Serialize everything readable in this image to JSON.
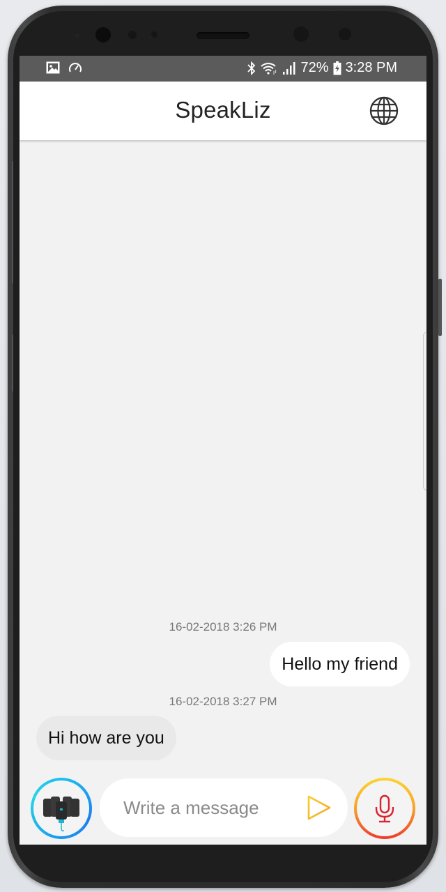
{
  "status_bar": {
    "left_icons": [
      "image-icon",
      "speedometer-icon"
    ],
    "right_icons": [
      "bluetooth-icon",
      "wifi-icon",
      "signal-icon"
    ],
    "battery": "72%",
    "battery_icon": "battery-charging-icon",
    "time": "3:28 PM"
  },
  "app_bar": {
    "title": "SpeakLiz",
    "language_icon": "globe-icon"
  },
  "messages": [
    {
      "timestamp": "16-02-2018  3:26 PM",
      "text": "Hello my friend",
      "direction": "outgoing"
    },
    {
      "timestamp": "16-02-2018  3:27 PM",
      "text": "Hi how are you",
      "direction": "incoming"
    }
  ],
  "composer": {
    "device_button_icon": "wearable-device-icon",
    "placeholder": "Write a message",
    "value": "",
    "send_icon": "send-triangle-icon",
    "mic_icon": "microphone-icon"
  },
  "colors": {
    "status_bar": "#5b5b5b",
    "chat_background": "#f2f2f2",
    "outgoing_bubble": "#ffffff",
    "incoming_bubble": "#e9e9e9",
    "device_ring": "#1aa0ef",
    "send_icon": "#f5b921",
    "mic_icon": "#d9232e"
  }
}
